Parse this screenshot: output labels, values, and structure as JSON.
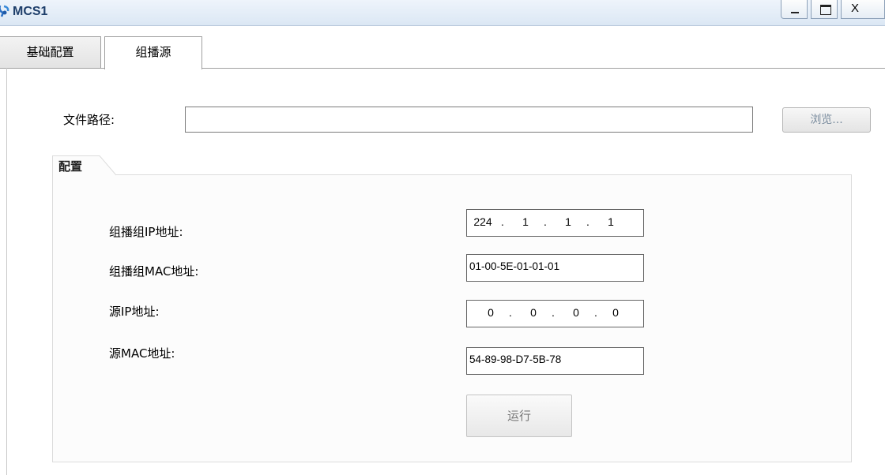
{
  "window": {
    "title": "MCS1",
    "minimize_label": "_",
    "close_label": "X"
  },
  "tabs": [
    {
      "label": "基础配置",
      "selected": false
    },
    {
      "label": "组播源",
      "selected": true
    }
  ],
  "file": {
    "label": "文件路径:",
    "value": "",
    "browse_label": "浏览..."
  },
  "config": {
    "group_label": "配置",
    "multicast_ip_label": "组播组IP地址:",
    "multicast_ip": [
      "224",
      "1",
      "1",
      "1"
    ],
    "multicast_mac_label": "组播组MAC地址:",
    "multicast_mac": "01-00-5E-01-01-01",
    "source_ip_label": "源IP地址:",
    "source_ip": [
      "0",
      "0",
      "0",
      "0"
    ],
    "source_mac_label": "源MAC地址:",
    "source_mac": "54-89-98-D7-5B-78",
    "run_label": "运行"
  },
  "colors": {
    "title_text": "#1f3f6b",
    "titlebar_bg": "#dbe7f4",
    "browse_text": "#7a8c9e"
  },
  "icons": {
    "app": "app-network-icon"
  }
}
